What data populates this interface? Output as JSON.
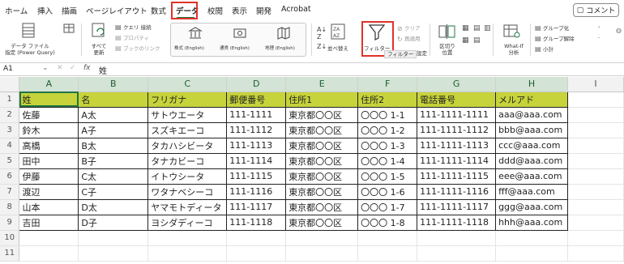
{
  "menu": {
    "tabs": [
      "ホーム",
      "挿入",
      "描画",
      "ページレイアウト",
      "数式",
      "データ",
      "校閲",
      "表示",
      "開発",
      "Acrobat"
    ],
    "active_tab": "データ",
    "comment_label": "コメント"
  },
  "ribbon": {
    "get_data": "データ ファイル\n指定 (Power Query)",
    "refresh_all": "すべて\n更新",
    "queries": "クエリ  接続",
    "properties": "プロパティ",
    "book_links": "ブックのリンク",
    "stocks": "株式 (English)",
    "currencies": "通貨 (English)",
    "geography": "地理 (English)",
    "sort": "並べ替え",
    "filter": "フィルター",
    "filter_tooltip": "フィルター",
    "clear": "クリア",
    "reapply": "再適用",
    "advanced": "設定",
    "text_to_columns": "区切り\n位置",
    "what_if": "What-If\n分析",
    "group": "グループ化",
    "ungroup": "グループ解除",
    "subtotal": "小計"
  },
  "formula_bar": {
    "name_box": "A1",
    "fx": "fx",
    "content": "姓"
  },
  "sheet": {
    "columns": [
      "A",
      "B",
      "C",
      "D",
      "E",
      "F",
      "G",
      "H",
      "I"
    ],
    "row_numbers": [
      "1",
      "2",
      "3",
      "4",
      "5",
      "6",
      "7",
      "8",
      "9",
      "10",
      "11"
    ],
    "header": [
      "姓",
      "名",
      "フリガナ",
      "郵便番号",
      "住所1",
      "住所2",
      "電話番号",
      "メルアド"
    ],
    "rows": [
      [
        "佐藤",
        "A太",
        "サトウエータ",
        "111-1111",
        "東京都〇〇区",
        "〇〇〇 1-1",
        "111-1111-1111",
        "aaa@aaa.com"
      ],
      [
        "鈴木",
        "A子",
        "スズキエーコ",
        "111-1112",
        "東京都〇〇区",
        "〇〇〇 1-2",
        "111-1111-1112",
        "bbb@aaa.com"
      ],
      [
        "高橋",
        "B太",
        "タカハシビータ",
        "111-1113",
        "東京都〇〇区",
        "〇〇〇 1-3",
        "111-1111-1113",
        "ccc@aaa.com"
      ],
      [
        "田中",
        "B子",
        "タナカビーコ",
        "111-1114",
        "東京都〇〇区",
        "〇〇〇 1-4",
        "111-1111-1114",
        "ddd@aaa.com"
      ],
      [
        "伊藤",
        "C太",
        "イトウシータ",
        "111-1115",
        "東京都〇〇区",
        "〇〇〇 1-5",
        "111-1111-1115",
        "eee@aaa.com"
      ],
      [
        "渡辺",
        "C子",
        "ワタナベシーコ",
        "111-1116",
        "東京都〇〇区",
        "〇〇〇 1-6",
        "111-1111-1116",
        "fff@aaa.com"
      ],
      [
        "山本",
        "D太",
        "ヤマモトディータ",
        "111-1117",
        "東京都〇〇区",
        "〇〇〇 1-7",
        "111-1111-1117",
        "ggg@aaa.com"
      ],
      [
        "吉田",
        "D子",
        "ヨシダディーコ",
        "111-1118",
        "東京都〇〇区",
        "〇〇〇 1-8",
        "111-1111-1118",
        "hhh@aaa.com"
      ]
    ]
  },
  "colors": {
    "accent": "#217346",
    "highlight_box": "#e0332b",
    "header_fill": "#c6d33b"
  }
}
